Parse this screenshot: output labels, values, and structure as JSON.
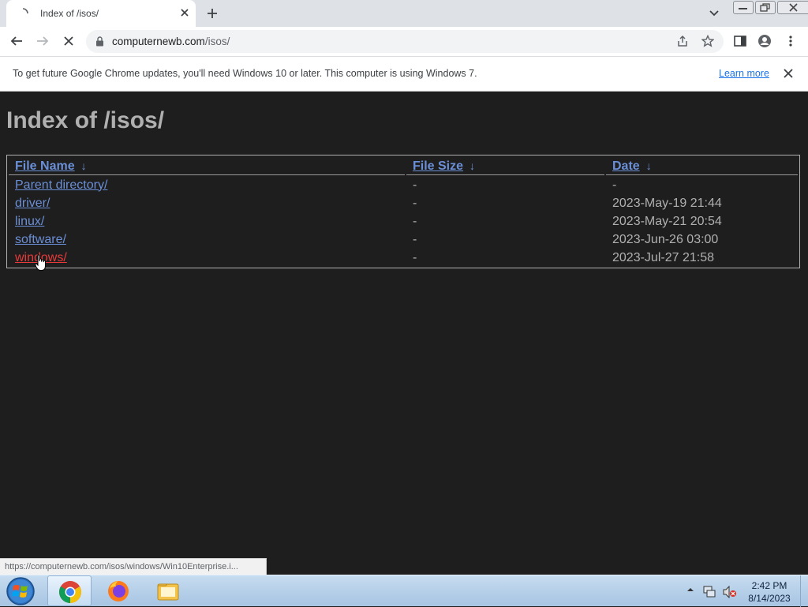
{
  "browser": {
    "tab_title": "Index of /isos/",
    "url_domain": "computernewb.com",
    "url_path": "/isos/"
  },
  "infobar": {
    "message": "To get future Google Chrome updates, you'll need Windows 10 or later. This computer is using Windows 7.",
    "learn_more": "Learn more"
  },
  "page": {
    "heading": "Index of /isos/",
    "columns": [
      "File Name",
      "File Size",
      "Date"
    ],
    "sort_arrow": "↓",
    "rows": [
      {
        "name": "Parent directory/",
        "size": "-",
        "date": "-"
      },
      {
        "name": "driver/",
        "size": "-",
        "date": "2023-May-19 21:44"
      },
      {
        "name": "linux/",
        "size": "-",
        "date": "2023-May-21 20:54"
      },
      {
        "name": "software/",
        "size": "-",
        "date": "2023-Jun-26 03:00"
      },
      {
        "name": "windows/",
        "size": "-",
        "date": "2023-Jul-27 21:58"
      }
    ]
  },
  "status_bubble": "https://computernewb.com/isos/windows/Win10Enterprise.i...",
  "taskbar": {
    "apps": [
      "chrome-icon",
      "firefox-icon",
      "file-explorer-icon"
    ],
    "time": "2:42 PM",
    "date": "8/14/2023"
  },
  "colors": {
    "page_bg": "#1e1e1e",
    "link": "#6b8fd6",
    "link_hover": "#e83a3a",
    "text": "#b0b0b0"
  }
}
